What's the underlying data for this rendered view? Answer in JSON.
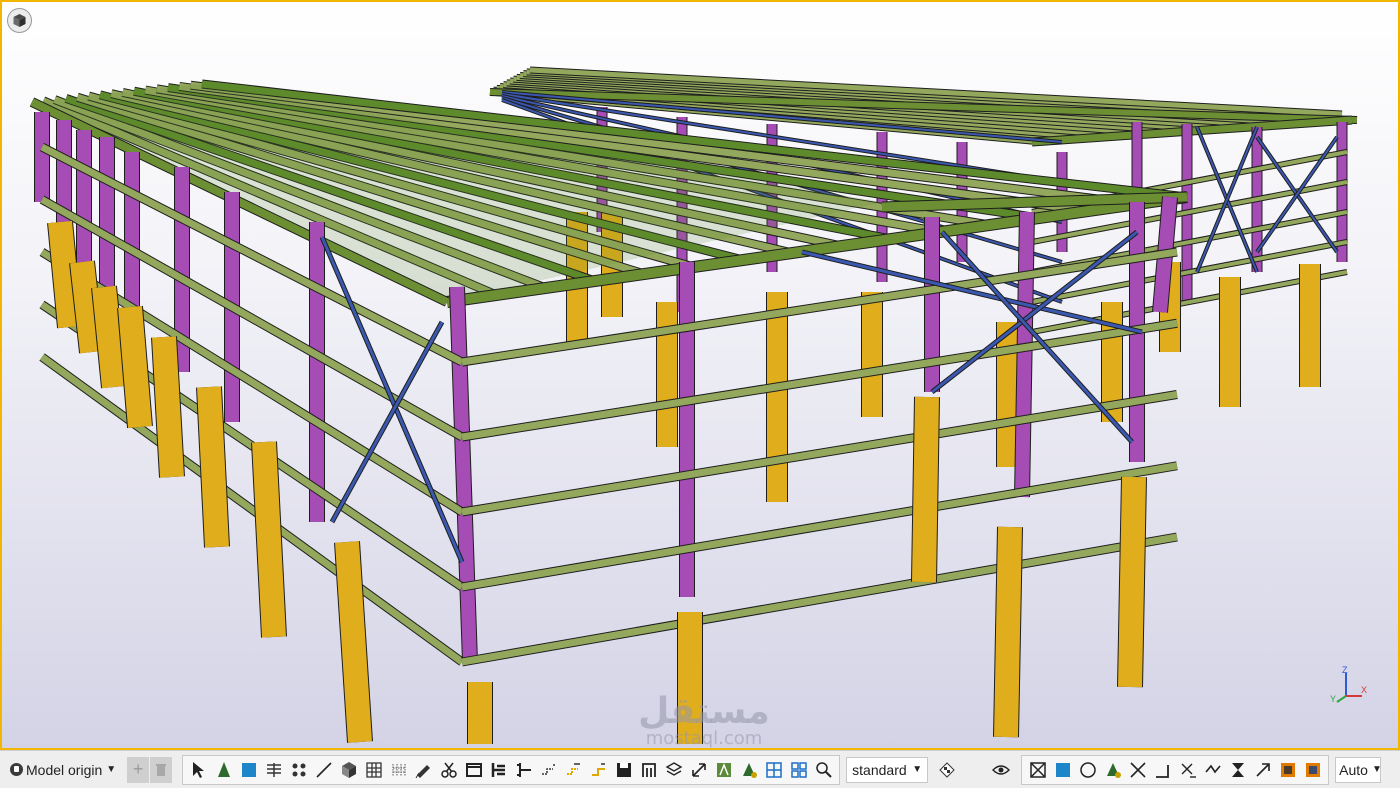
{
  "viewport": {
    "border_color": "#f2b600",
    "background_top": "#ffffff",
    "background_bottom": "#d4d3e6",
    "model_colors": {
      "columns": "#a54cb5",
      "footings": "#e0ad1c",
      "beams": "#6b8f32",
      "purlins": "#93a85c",
      "bracing": "#3b58b0",
      "roof_panels": "#5d8a2b"
    },
    "view_cube_icon": "cube-icon",
    "axis_labels": {
      "z": "Z",
      "x": "X",
      "y": "Y"
    }
  },
  "watermark": {
    "main": "مستقل",
    "sub": "mostaql.com"
  },
  "toolbar": {
    "origin_label": "Model origin",
    "origin_icon": "globe-icon",
    "add_icon": "plus-icon",
    "delete_icon": "trash-icon",
    "view_style": "standard",
    "zoom_mode": "Auto",
    "select_tools": [
      "arrow-icon",
      "cone-icon",
      "square-icon",
      "grid-lines-icon",
      "dots-icon",
      "line-icon",
      "cube-icon",
      "grid-icon",
      "hatch-icon",
      "pencil-icon",
      "scissors-icon",
      "frame-icon",
      "beam-icon",
      "weld-icon",
      "snap-icon",
      "snap-yellow-icon",
      "snap-angle-icon",
      "save-icon",
      "bracket-icon",
      "layers-icon",
      "rotate-icon",
      "mesh-icon",
      "triangle-icon",
      "grid-blue-icon",
      "grid-blue2-icon",
      "zoom-icon"
    ],
    "snap_tools": [
      "box-x-icon",
      "square-icon",
      "circle-icon",
      "triangle-icon",
      "x-icon",
      "corner-icon",
      "x-line-icon",
      "wave-icon",
      "hourglass-icon",
      "arrow-diagonal-icon",
      "square-orange-icon",
      "square-dotted-icon"
    ]
  }
}
